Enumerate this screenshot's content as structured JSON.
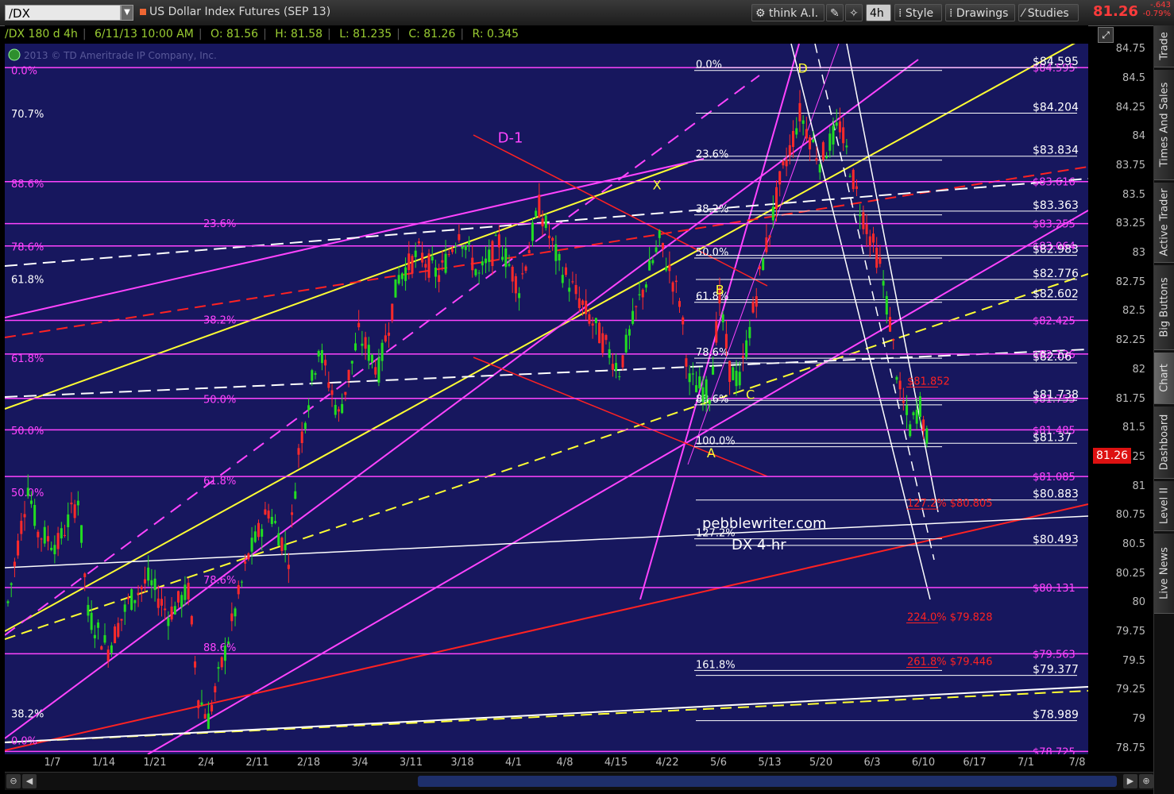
{
  "toolbar": {
    "symbol": "/DX",
    "title": "US Dollar Index Futures (SEP 13)",
    "think_label": "think A.I.",
    "timeframe_label": "4h",
    "style_label": "Style",
    "drawings_label": "Drawings",
    "studies_label": "Studies",
    "last_price": "81.26",
    "change": "-.643",
    "change_pct": "-0.79%"
  },
  "infobar": {
    "study": "/DX 180 d 4h",
    "datetime": "6/11/13 10:00 AM",
    "open": "O: 81.56",
    "high": "H: 81.58",
    "low": "L: 81.235",
    "close": "C: 81.26",
    "range": "R: 0.345"
  },
  "copyright": "2013 © TD Ameritrade IP Company, Inc.",
  "watermark": {
    "site": "pebblewriter.com",
    "label": "DX 4-hr"
  },
  "sidebar": {
    "tabs": [
      "Trade",
      "Times And Sales",
      "Active Trader",
      "Big Buttons",
      "Chart",
      "Dashboard",
      "Level II",
      "Live News"
    ]
  },
  "colors": {
    "background": "#17175e",
    "up_candle": "#22dd22",
    "down_candle": "#ff2a2a",
    "fib_magenta": "#ff44ff",
    "channel_yellow": "#ffff33",
    "channel_white": "#ffffff",
    "channel_red": "#ff2222"
  },
  "chart_data": {
    "type": "candlestick",
    "symbol": "/DX",
    "ylim": [
      78.7,
      84.8
    ],
    "y_ticks": [
      "84.75",
      "84.5",
      "84.25",
      "84",
      "83.75",
      "83.5",
      "83.25",
      "83",
      "82.75",
      "82.5",
      "82.25",
      "82",
      "81.75",
      "81.5",
      "81.25",
      "81",
      "80.75",
      "80.5",
      "80.25",
      "80",
      "79.75",
      "79.5",
      "79.25",
      "79",
      "78.75"
    ],
    "x_ticks": [
      "1/7",
      "1/14",
      "1/21",
      "2/4",
      "2/11",
      "2/18",
      "3/4",
      "3/11",
      "3/18",
      "4/1",
      "4/8",
      "4/15",
      "4/22",
      "5/6",
      "5/13",
      "5/20",
      "6/3",
      "6/10",
      "6/17",
      "7/1",
      "7/8"
    ],
    "last_price_label": "81.26",
    "price_path": [
      [
        0,
        80.0
      ],
      [
        2,
        81.0
      ],
      [
        3,
        80.6
      ],
      [
        5,
        80.5
      ],
      [
        7,
        80.9
      ],
      [
        8,
        79.9
      ],
      [
        10,
        79.6
      ],
      [
        12,
        80.0
      ],
      [
        14,
        80.2
      ],
      [
        16,
        79.9
      ],
      [
        18,
        80.1
      ],
      [
        19,
        79.2
      ],
      [
        20,
        79.0
      ],
      [
        22,
        79.7
      ],
      [
        24,
        80.4
      ],
      [
        26,
        80.8
      ],
      [
        28,
        80.4
      ],
      [
        29,
        81.3
      ],
      [
        31,
        82.2
      ],
      [
        33,
        81.6
      ],
      [
        35,
        82.3
      ],
      [
        37,
        82.0
      ],
      [
        39,
        82.8
      ],
      [
        41,
        83.0
      ],
      [
        43,
        82.8
      ],
      [
        45,
        83.2
      ],
      [
        47,
        82.8
      ],
      [
        49,
        83.1
      ],
      [
        51,
        82.7
      ],
      [
        53,
        83.4
      ],
      [
        55,
        82.9
      ],
      [
        57,
        82.6
      ],
      [
        59,
        82.3
      ],
      [
        61,
        82.0
      ],
      [
        63,
        82.6
      ],
      [
        65,
        83.1
      ],
      [
        67,
        82.6
      ],
      [
        68,
        81.9
      ],
      [
        70,
        81.8
      ],
      [
        71,
        82.6
      ],
      [
        72,
        82.0
      ],
      [
        73,
        81.9
      ],
      [
        75,
        82.8
      ],
      [
        77,
        83.6
      ],
      [
        79,
        84.2
      ],
      [
        81,
        83.8
      ],
      [
        83,
        84.1
      ],
      [
        85,
        83.4
      ],
      [
        87,
        82.9
      ],
      [
        88,
        82.4
      ],
      [
        89,
        81.8
      ],
      [
        90,
        81.5
      ],
      [
        91,
        81.7
      ],
      [
        92,
        81.26
      ]
    ],
    "pattern_points": [
      {
        "label": "D-1",
        "x": 0.455,
        "price": 83.95,
        "color": "#ff44ff"
      },
      {
        "label": "X",
        "x": 0.598,
        "price": 83.55,
        "color": "#ffff33"
      },
      {
        "label": "B",
        "x": 0.656,
        "price": 82.65,
        "color": "#ffff33"
      },
      {
        "label": "C",
        "x": 0.684,
        "price": 81.75,
        "color": "#ffff33"
      },
      {
        "label": "A",
        "x": 0.648,
        "price": 81.25,
        "color": "#ffff33"
      },
      {
        "label": "D",
        "x": 0.732,
        "price": 84.55,
        "color": "#ffff33"
      }
    ],
    "levels_white": [
      {
        "price": 84.595,
        "label": "$84.595"
      },
      {
        "price": 84.204,
        "label": "$84.204"
      },
      {
        "price": 83.834,
        "label": "$83.834"
      },
      {
        "price": 83.363,
        "label": "$83.363"
      },
      {
        "price": 82.983,
        "label": "$82.983"
      },
      {
        "price": 82.776,
        "label": "$82.776"
      },
      {
        "price": 82.602,
        "label": "$82.602"
      },
      {
        "price": 82.06,
        "label": "$82.06"
      },
      {
        "price": 81.738,
        "label": "$81.738"
      },
      {
        "price": 81.37,
        "label": "$81.37"
      },
      {
        "price": 80.883,
        "label": "$80.883"
      },
      {
        "price": 80.493,
        "label": "$80.493"
      },
      {
        "price": 79.377,
        "label": "$79.377"
      },
      {
        "price": 78.989,
        "label": "$78.989"
      }
    ],
    "levels_magenta": [
      {
        "price": 84.595,
        "label": "$84.595"
      },
      {
        "price": 83.616,
        "label": "$83.616"
      },
      {
        "price": 83.255,
        "label": "$83.255"
      },
      {
        "price": 83.064,
        "label": "$83.064"
      },
      {
        "price": 82.425,
        "label": "$82.425"
      },
      {
        "price": 82.136,
        "label": "$82.136"
      },
      {
        "price": 81.755,
        "label": "$81.755"
      },
      {
        "price": 81.485,
        "label": "$81.485"
      },
      {
        "price": 81.085,
        "label": "$81.085"
      },
      {
        "price": 80.131,
        "label": "$80.131"
      },
      {
        "price": 79.563,
        "label": "$79.563"
      },
      {
        "price": 78.725,
        "label": "$78.725"
      }
    ],
    "levels_red": [
      {
        "price": 81.852,
        "label": "$81.852"
      },
      {
        "price": 79.828,
        "label": "224.0%   $79.828"
      },
      {
        "price": 79.446,
        "label": "261.8%  $79.446"
      },
      {
        "price": 80.805,
        "label": "127.2%  $80.805"
      }
    ],
    "fib_left_pct": [
      {
        "price": 84.57,
        "label": "0.0%"
      },
      {
        "price": 84.2,
        "label": "70.7%"
      },
      {
        "price": 83.6,
        "label": "88.6%"
      },
      {
        "price": 83.06,
        "label": "78.6%"
      },
      {
        "price": 82.78,
        "label": "61.8%"
      },
      {
        "price": 82.1,
        "label": "61.8%"
      },
      {
        "price": 81.48,
        "label": "50.0%"
      },
      {
        "price": 80.95,
        "label": "50.0%"
      },
      {
        "price": 79.05,
        "label": "38.2%"
      },
      {
        "price": 78.82,
        "label": "0.0%"
      }
    ],
    "fib_mid_pct": [
      {
        "price": 83.26,
        "label": "23.6%"
      },
      {
        "price": 82.43,
        "label": "38.2%"
      },
      {
        "price": 81.75,
        "label": "50.0%"
      },
      {
        "price": 81.05,
        "label": "61.8%"
      },
      {
        "price": 80.2,
        "label": "78.6%"
      },
      {
        "price": 79.62,
        "label": "88.6%"
      }
    ],
    "fib_xa_pct": [
      {
        "price": 84.57,
        "label": "0.0%"
      },
      {
        "price": 83.8,
        "label": "23.6%"
      },
      {
        "price": 83.33,
        "label": "38.2%"
      },
      {
        "price": 82.96,
        "label": "50.0%"
      },
      {
        "price": 82.58,
        "label": "61.8%"
      },
      {
        "price": 82.1,
        "label": "78.6%"
      },
      {
        "price": 81.7,
        "label": "88.6%"
      },
      {
        "price": 81.34,
        "label": "100.0%"
      },
      {
        "price": 80.55,
        "label": "127.2%"
      },
      {
        "price": 79.42,
        "label": "161.8%"
      }
    ]
  }
}
